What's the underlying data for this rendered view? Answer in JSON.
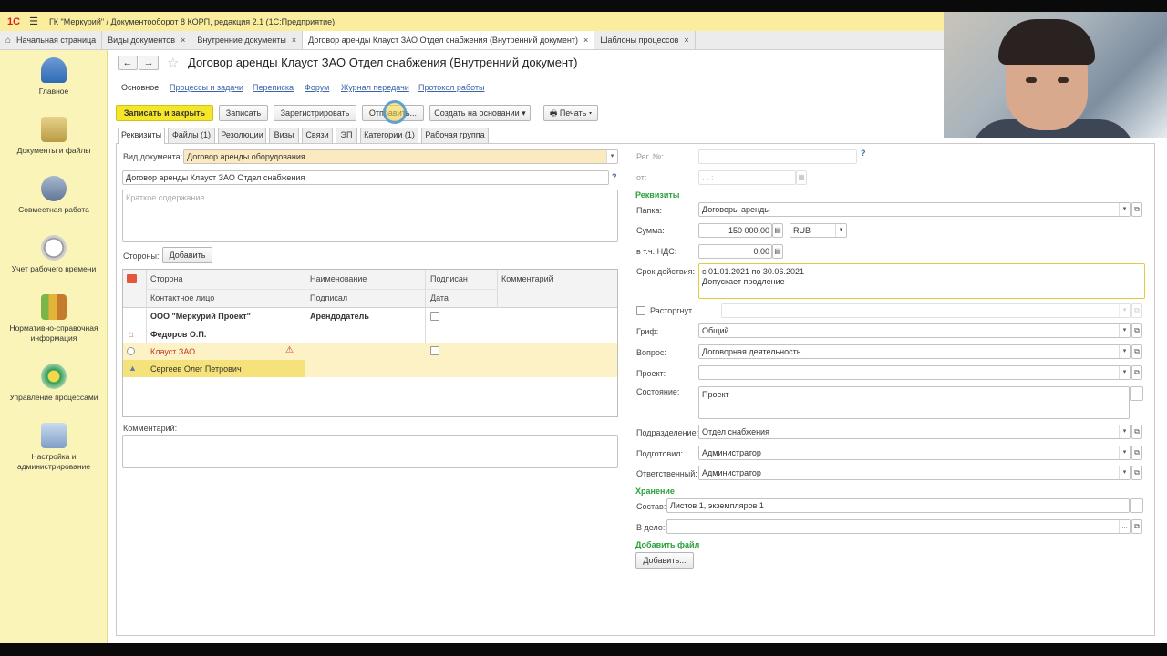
{
  "app": {
    "logo": "1С",
    "menu_icon": "☰",
    "title": "ГК \"Меркурий\" / Документооборот 8 КОРП, редакция 2.1  (1С:Предприятие)"
  },
  "open_tabs": [
    {
      "label": "Начальная страница",
      "closable": false
    },
    {
      "label": "Виды документов",
      "closable": true
    },
    {
      "label": "Внутренние документы",
      "closable": true
    },
    {
      "label": "Договор аренды Клауст ЗАО Отдел снабжения (Внутренний документ)",
      "closable": true
    },
    {
      "label": "Шаблоны процессов",
      "closable": true
    }
  ],
  "tab_close": "×",
  "sidebar": [
    {
      "label": "Главное",
      "icon": "home-icon"
    },
    {
      "label": "Документы и файлы",
      "icon": "documents-icon"
    },
    {
      "label": "Совместная работа",
      "icon": "team-icon"
    },
    {
      "label": "Учет рабочего времени",
      "icon": "clock-icon"
    },
    {
      "label": "Нормативно-справочная информация",
      "icon": "books-icon"
    },
    {
      "label": "Управление процессами",
      "icon": "process-icon"
    },
    {
      "label": "Настройка и администрирование",
      "icon": "settings-icon"
    }
  ],
  "document": {
    "title": "Договор аренды Клауст ЗАО Отдел снабжения (Внутренний документ)",
    "back": "←",
    "forward": "→",
    "star": "☆"
  },
  "nav_links": [
    "Основное",
    "Процессы и задачи",
    "Переписка",
    "Форум",
    "Журнал передачи",
    "Протокол работы"
  ],
  "toolbar": {
    "save_close": "Записать и закрыть",
    "save": "Записать",
    "register": "Зарегистрировать",
    "send": "Отправить...",
    "create_based": "Создать на основании",
    "print": "Печать"
  },
  "form_tabs": [
    "Реквизиты",
    "Файлы (1)",
    "Резолюции",
    "Визы",
    "Связи",
    "ЭП",
    "Категории (1)",
    "Рабочая группа"
  ],
  "left": {
    "doc_type_label": "Вид документа:",
    "doc_type_value": "Договор аренды оборудования",
    "doc_name": "Договор аренды Клауст ЗАО Отдел снабжения",
    "summary_placeholder": "Краткое содержание",
    "parties_label": "Стороны:",
    "add_button": "Добавить",
    "comment_label": "Комментарий:",
    "help": "?"
  },
  "parties_table": {
    "headers_row1": [
      "Сторона",
      "Наименование",
      "Подписан",
      "Комментарий"
    ],
    "headers_row2": [
      "Контактное лицо",
      "Подписал",
      "Дата"
    ],
    "rows": [
      {
        "party": "ООО \"Меркурий Проект\"",
        "name": "Арендодатель",
        "signed": false,
        "contact": "Федоров О.П."
      },
      {
        "party": "Клауст ЗАО",
        "name": "",
        "signed": false,
        "contact": "Сергеев Олег Петрович",
        "warning": true
      }
    ]
  },
  "right": {
    "reg_no_label": "Рег. №:",
    "from_label": "от:",
    "date_mask": ". .    :",
    "requisites_header": "Реквизиты",
    "folder_label": "Папка:",
    "folder_value": "Договоры аренды",
    "sum_label": "Сумма:",
    "sum_value": "150 000,00",
    "currency": "RUB",
    "vat_label": "в т.ч. НДС:",
    "vat_value": "0,00",
    "term_label": "Срок действия:",
    "term_line1": "с 01.01.2021 по 30.06.2021",
    "term_line2": "Допускает продление",
    "terminated_label": "Расторгнут",
    "grif_label": "Гриф:",
    "grif_value": "Общий",
    "question_label": "Вопрос:",
    "question_value": "Договорная деятельность",
    "project_label": "Проект:",
    "project_value": "",
    "state_label": "Состояние:",
    "state_value": "Проект",
    "department_label": "Подразделение:",
    "department_value": "Отдел снабжения",
    "prepared_label": "Подготовил:",
    "prepared_value": "Администратор",
    "responsible_label": "Ответственный:",
    "responsible_value": "Администратор",
    "storage_header": "Хранение",
    "composition_label": "Состав:",
    "composition_value": "Листов 1, экземпляров 1",
    "case_label": "В дело:",
    "case_value": "",
    "add_file_header": "Добавить файл",
    "add_file_button": "Добавить...",
    "help": "?"
  },
  "colors": {
    "accent_yellow": "#f5e628",
    "title_bar": "#fbed9e",
    "sidebar": "#fbf4b8",
    "link": "#3b64a8",
    "section_green": "#2aa03c"
  }
}
